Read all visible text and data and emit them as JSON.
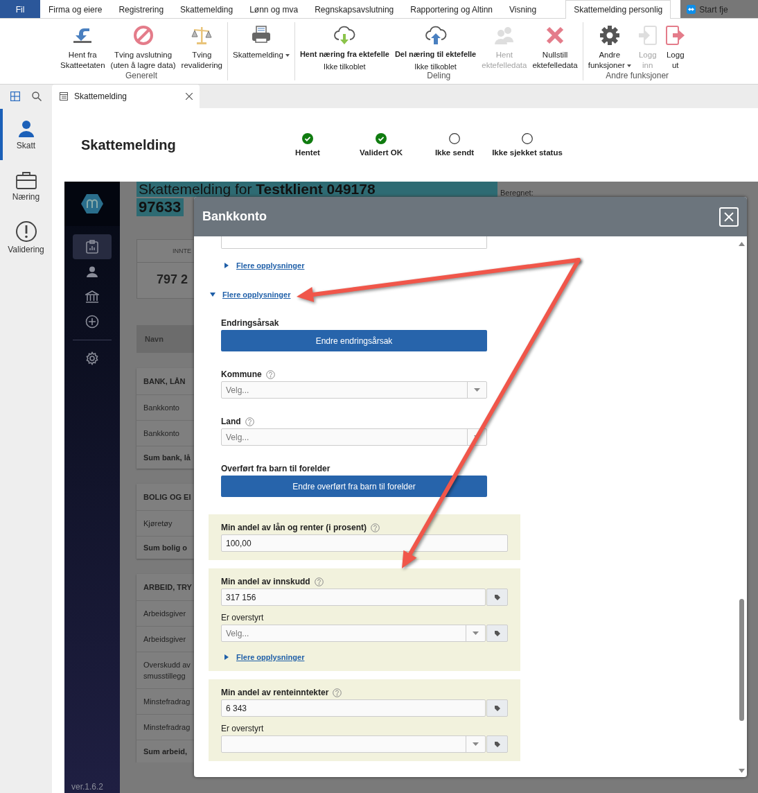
{
  "ribbon": {
    "tabs": [
      {
        "label": "Fil",
        "kind": "file",
        "selected": false
      },
      {
        "label": "Firma og eiere",
        "kind": "tab",
        "selected": false
      },
      {
        "label": "Registrering",
        "kind": "tab",
        "selected": false
      },
      {
        "label": "Skattemelding",
        "kind": "tab",
        "selected": false
      },
      {
        "label": "Lønn og mva",
        "kind": "tab",
        "selected": false
      },
      {
        "label": "Regnskapsavslutning",
        "kind": "tab",
        "selected": false
      },
      {
        "label": "Rapportering og Altinn",
        "kind": "tab",
        "selected": false
      },
      {
        "label": "Visning",
        "kind": "tab",
        "selected": false
      },
      {
        "label": "Skattemelding personlig",
        "kind": "tab",
        "selected": true
      },
      {
        "label": "Start fje",
        "kind": "app",
        "selected": false
      }
    ],
    "groups": [
      {
        "label": "Generelt",
        "buttons": [
          {
            "label": "Hent fra\nSkatteetaten",
            "disabled": false,
            "dropdown": false
          },
          {
            "label": "Tving avslutning\n(uten å lagre data)",
            "disabled": false,
            "dropdown": false
          },
          {
            "label": "Tving\nrevalidering",
            "disabled": false,
            "dropdown": false
          }
        ]
      },
      {
        "buttons": [
          {
            "label": "Skattemelding",
            "disabled": false,
            "dropdown": true
          }
        ]
      },
      {
        "label": "Deling",
        "buttons": [
          {
            "label": "Hent næring fra ektefelle",
            "sublabel": "Ikke tilkoblet",
            "disabled": false,
            "dropdown": false
          },
          {
            "label": "Del næring til ektefelle",
            "sublabel": "Ikke tilkoblet",
            "disabled": false,
            "dropdown": false
          },
          {
            "label": "Hent\nektefelledata",
            "disabled": true,
            "dropdown": false
          },
          {
            "label": "Nullstill\nektefelledata",
            "disabled": false,
            "dropdown": false
          }
        ]
      },
      {
        "label": "Andre funksjoner",
        "buttons": [
          {
            "label": "Andre\nfunksjoner",
            "disabled": false,
            "dropdown": true
          },
          {
            "label": "Logg\ninn",
            "disabled": true,
            "dropdown": false
          },
          {
            "label": "Logg\nut",
            "disabled": false,
            "dropdown": false
          }
        ]
      }
    ]
  },
  "rail": {
    "items": [
      {
        "label": "Skatt",
        "selected": true
      },
      {
        "label": "Næring",
        "selected": false
      },
      {
        "label": "Validering",
        "selected": false
      }
    ]
  },
  "document_tab": {
    "title": "Skattemelding"
  },
  "header": {
    "title": "Skattemelding",
    "steps": [
      {
        "label": "Hentet",
        "done": true
      },
      {
        "label": "Validert OK",
        "done": true
      },
      {
        "label": "Ikke sendt",
        "done": false
      },
      {
        "label": "Ikke sjekket status",
        "done": false
      }
    ]
  },
  "background": {
    "sidebar": {
      "items": [
        {
          "selected": true
        },
        {
          "selected": false
        },
        {
          "selected": false
        },
        {
          "selected": false
        },
        {
          "selected": false
        }
      ],
      "version": "ver.1.6.2"
    },
    "title": "Skattemelding for **Testklient 049178**",
    "title_line_2": "97633",
    "computed_label": "Beregnet:",
    "summary_card": {
      "header": "INNTE",
      "value": "797 2"
    },
    "table_header": "Navn",
    "cards": [
      {
        "rows": [
          {
            "text": "BANK, LÅN",
            "kind": "section"
          },
          {
            "text": "Bankkonto",
            "kind": "item"
          },
          {
            "text": "Bankkonto",
            "kind": "item"
          },
          {
            "text": "Sum bank, lå",
            "kind": "sum"
          }
        ]
      },
      {
        "rows": [
          {
            "text": "BOLIG OG EI",
            "kind": "section"
          },
          {
            "text": "Kjøretøy",
            "kind": "item"
          },
          {
            "text": "Sum bolig o",
            "kind": "sum"
          }
        ]
      },
      {
        "rows": [
          {
            "text": "ARBEID, TRY",
            "kind": "section"
          },
          {
            "text": "Arbeidsgiver",
            "kind": "item"
          },
          {
            "text": "Arbeidsgiver",
            "kind": "item"
          },
          {
            "text": "Overskudd av smusstillegg",
            "kind": "item"
          },
          {
            "text": "Minstefradrag",
            "kind": "item"
          },
          {
            "text": "Minstefradrag",
            "kind": "item"
          },
          {
            "text": "Sum arbeid,",
            "kind": "sum"
          }
        ]
      }
    ]
  },
  "modal": {
    "title": "Bankkonto",
    "blocks": [
      {
        "kind": "cut-field"
      },
      {
        "kind": "more",
        "label": "Flere opplysninger",
        "expanded": false
      },
      {
        "kind": "more",
        "label": "Flere opplysninger",
        "expanded": true
      },
      {
        "kind": "action",
        "label": "Endringsårsak",
        "button": "Endre endringsårsak"
      },
      {
        "kind": "select",
        "label": "Kommune",
        "help": true,
        "placeholder": "Velg...",
        "tag": false
      },
      {
        "kind": "select",
        "label": "Land",
        "help": true,
        "placeholder": "Velg...",
        "tag": false
      },
      {
        "kind": "action",
        "label": "Overført fra barn til forelder",
        "button": "Endre overført fra barn til forelder"
      },
      {
        "kind": "panel",
        "items": [
          {
            "kind": "input",
            "label": "Min andel av lån og renter (i prosent)",
            "help": true,
            "value": "100,00",
            "tag": false
          }
        ]
      },
      {
        "kind": "panel",
        "items": [
          {
            "kind": "input",
            "label": "Min andel av innskudd",
            "help": true,
            "value": "317 156",
            "tag": true
          },
          {
            "kind": "select",
            "label": "Er overstyrt",
            "help": false,
            "placeholder": "Velg...",
            "tag": true
          },
          {
            "kind": "more",
            "label": "Flere opplysninger",
            "expanded": false
          }
        ]
      },
      {
        "kind": "panel",
        "items": [
          {
            "kind": "input",
            "label": "Min andel av renteinntekter",
            "help": true,
            "value": "6 343",
            "tag": true
          },
          {
            "kind": "select",
            "label": "Er overstyrt",
            "help": false,
            "tag": true
          }
        ]
      }
    ]
  }
}
